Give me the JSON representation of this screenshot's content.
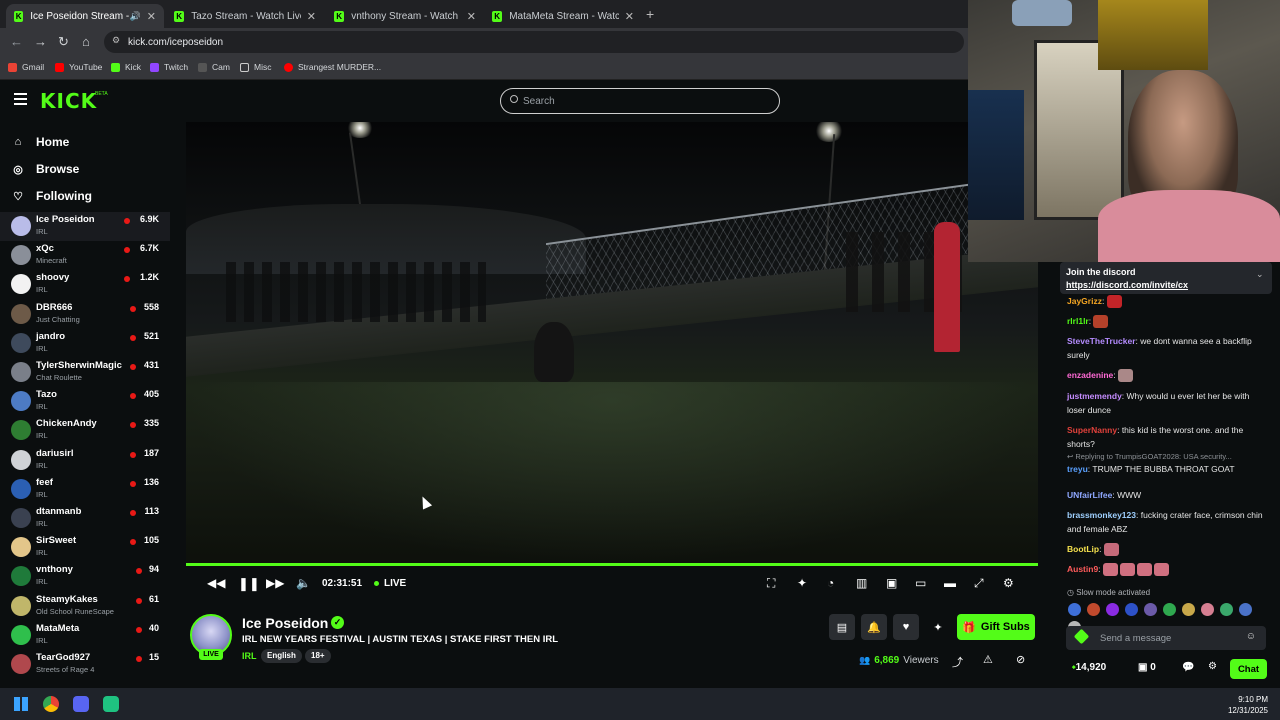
{
  "browser": {
    "tabs": [
      {
        "title": "Ice Poseidon Stream - Watc",
        "active": true
      },
      {
        "title": "Tazo Stream - Watch Live on Ki",
        "active": false
      },
      {
        "title": "vnthony Stream - Watch Live o",
        "active": false
      },
      {
        "title": "MataMeta Stream - Watch Live",
        "active": false
      }
    ],
    "new_tab": "+",
    "url": "kick.com/iceposeidon",
    "bookmarks": [
      "Gmail",
      "YouTube",
      "Kick",
      "Twitch",
      "Cam",
      "Misc",
      "Strangest MURDER..."
    ]
  },
  "header": {
    "logo": "KICK",
    "beta": "BETA",
    "search_placeholder": "Search"
  },
  "sidebar": {
    "nav": [
      {
        "label": "Home",
        "icon": "home-icon"
      },
      {
        "label": "Browse",
        "icon": "compass-icon"
      },
      {
        "label": "Following",
        "icon": "heart-icon"
      }
    ],
    "channels": [
      {
        "name": "Ice Poseidon",
        "category": "IRL",
        "viewers": "6.9K",
        "color": "#b9bce8",
        "selected": true
      },
      {
        "name": "xQc",
        "category": "Minecraft",
        "viewers": "6.7K",
        "color": "#8a8f99"
      },
      {
        "name": "shoovy",
        "category": "IRL",
        "viewers": "1.2K",
        "color": "#f2f2f2"
      },
      {
        "name": "DBR666",
        "category": "Just Chatting",
        "viewers": "558",
        "color": "#6d5a48"
      },
      {
        "name": "jandro",
        "category": "IRL",
        "viewers": "521",
        "color": "#3e4a5c"
      },
      {
        "name": "TylerSherwinMagic",
        "category": "Chat Roulette",
        "viewers": "431",
        "color": "#7a7f89"
      },
      {
        "name": "Tazo",
        "category": "IRL",
        "viewers": "405",
        "color": "#4d7bc4"
      },
      {
        "name": "ChickenAndy",
        "category": "IRL",
        "viewers": "335",
        "color": "#2e7d32"
      },
      {
        "name": "dariusirl",
        "category": "IRL",
        "viewers": "187",
        "color": "#cfd2d6"
      },
      {
        "name": "feef",
        "category": "IRL",
        "viewers": "136",
        "color": "#2b5fb3"
      },
      {
        "name": "dtanmanb",
        "category": "IRL",
        "viewers": "113",
        "color": "#3a4150"
      },
      {
        "name": "SirSweet",
        "category": "IRL",
        "viewers": "105",
        "color": "#e3c68a"
      },
      {
        "name": "vnthony",
        "category": "IRL",
        "viewers": "94",
        "color": "#1f7a3a"
      },
      {
        "name": "SteamyKakes",
        "category": "Old School RuneScape",
        "viewers": "61",
        "color": "#c0b66a"
      },
      {
        "name": "MataMeta",
        "category": "IRL",
        "viewers": "40",
        "color": "#2fbf4c"
      },
      {
        "name": "TearGod927",
        "category": "Streets of Rage 4",
        "viewers": "15",
        "color": "#b0484d"
      }
    ]
  },
  "player": {
    "progress": 1.0,
    "timecode": "02:31:51",
    "live_label": "LIVE"
  },
  "stream": {
    "streamer": "Ice Poseidon",
    "live_tag": "LIVE",
    "title": "IRL NEW YEARS FESTIVAL | AUSTIN TEXAS | STAKE FIRST THEN IRL",
    "category": "IRL",
    "tags": [
      "English",
      "18+"
    ],
    "gift_label": "Gift Subs",
    "viewers": "6,869",
    "viewers_label": "Viewers"
  },
  "chat": {
    "pinned_title": "Join the discord",
    "pinned_link": "https://discord.com/invite/cx",
    "messages": [
      {
        "user": "JayGrizz",
        "text": "",
        "color": "#f5a623"
      },
      {
        "user": "rlrl1lr",
        "text": "",
        "color": "#53fc18"
      },
      {
        "user": "SteveTheTrucker",
        "text": "we dont wanna see a backflip surely",
        "color": "#b58cff"
      },
      {
        "user": "enzadenine",
        "text": "",
        "color": "#ff6ad5"
      },
      {
        "user": "justmemendy",
        "text": "Why would u ever let her be with loser dunce",
        "color": "#c58cff"
      },
      {
        "user": "SuperNanny",
        "text": "this kid is the worst one. and the shorts?",
        "color": "#e0413b"
      },
      {
        "user": "treyu",
        "text": "TRUMP THE BUBBA THROAT GOAT",
        "color": "#5aa0ff"
      },
      {
        "user": "UNfairLifee",
        "text": "WWW",
        "color": "#8fa8ff"
      },
      {
        "user": "brassmonkey123",
        "text": "fucking crater face, crimson chin and female ABZ",
        "color": "#9fd0ff"
      },
      {
        "user": "BootLip",
        "text": "",
        "color": "#f4e04d"
      },
      {
        "user": "Austin9",
        "text": "",
        "color": "#ff5b5b"
      }
    ],
    "reply_text": "Replying to TrumpisGOAT2028: USA security...",
    "slow_mode": "Slow mode activated",
    "send_placeholder": "Send a message",
    "points": "14,920",
    "gifts": "0",
    "chat_button": "Chat"
  },
  "taskbar": {
    "time": "9:10 PM",
    "date": "12/31/2025"
  },
  "colors": {
    "kick_green": "#53fc18",
    "bg": "#0b0e0f",
    "live_red": "#e91916"
  }
}
